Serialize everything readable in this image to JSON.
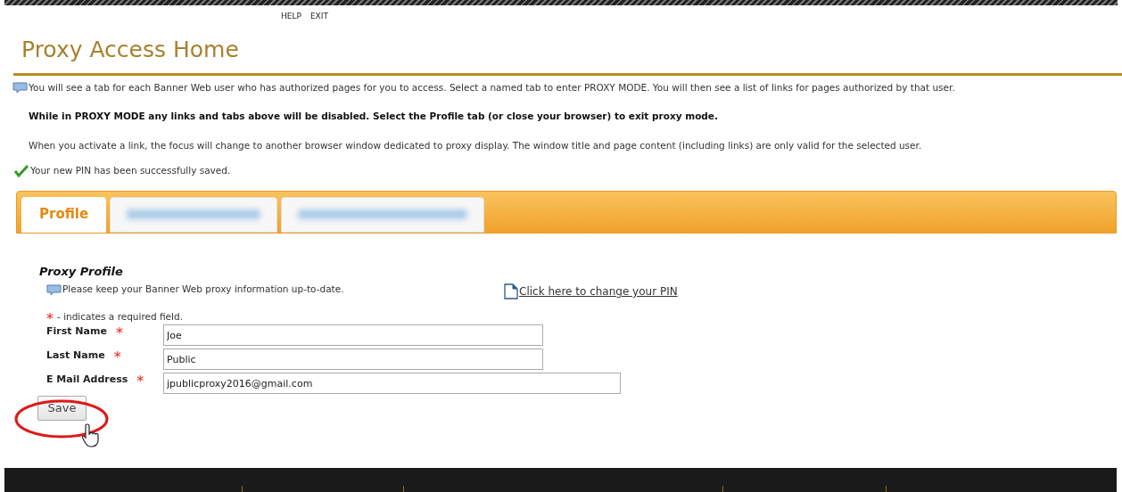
{
  "top_links": [
    "HELP",
    "EXIT"
  ],
  "title": "Proxy Access Home",
  "intro": "You will see a tab for each Banner Web user who has authorized pages for you to access. Select a named tab to enter PROXY MODE. You will then see a list of links for pages authorized by that user.",
  "warning": "While in PROXY MODE any links and tabs above will be disabled. Select the Profile tab (or close your browser) to exit proxy mode.",
  "note": "When you activate a link, the focus will change to another browser window dedicated to proxy display. The window title and page content (including links) are only valid for the selected user.",
  "success": "Your new PIN has been successfully saved.",
  "tabs": [
    {
      "label": "Profile",
      "selected": true
    },
    {
      "selected": false
    },
    {
      "selected": false
    }
  ],
  "section_title": "Proxy Profile",
  "section_hint": "Please keep your Banner Web proxy information up-to-date.",
  "pin_link": "Click here to change your PIN",
  "required_legend": {
    "mark": "*",
    "text": "- indicates a required field."
  },
  "fields": [
    {
      "label": "First Name",
      "required_mark": "*",
      "value": "Joe",
      "wide": false
    },
    {
      "label": "Last Name",
      "required_mark": "*",
      "value": "Public",
      "wide": false
    },
    {
      "label": "E Mail Address",
      "required_mark": "*",
      "value": "jpublicproxy2016@gmail.com",
      "wide": true
    }
  ],
  "save_button": "Save"
}
